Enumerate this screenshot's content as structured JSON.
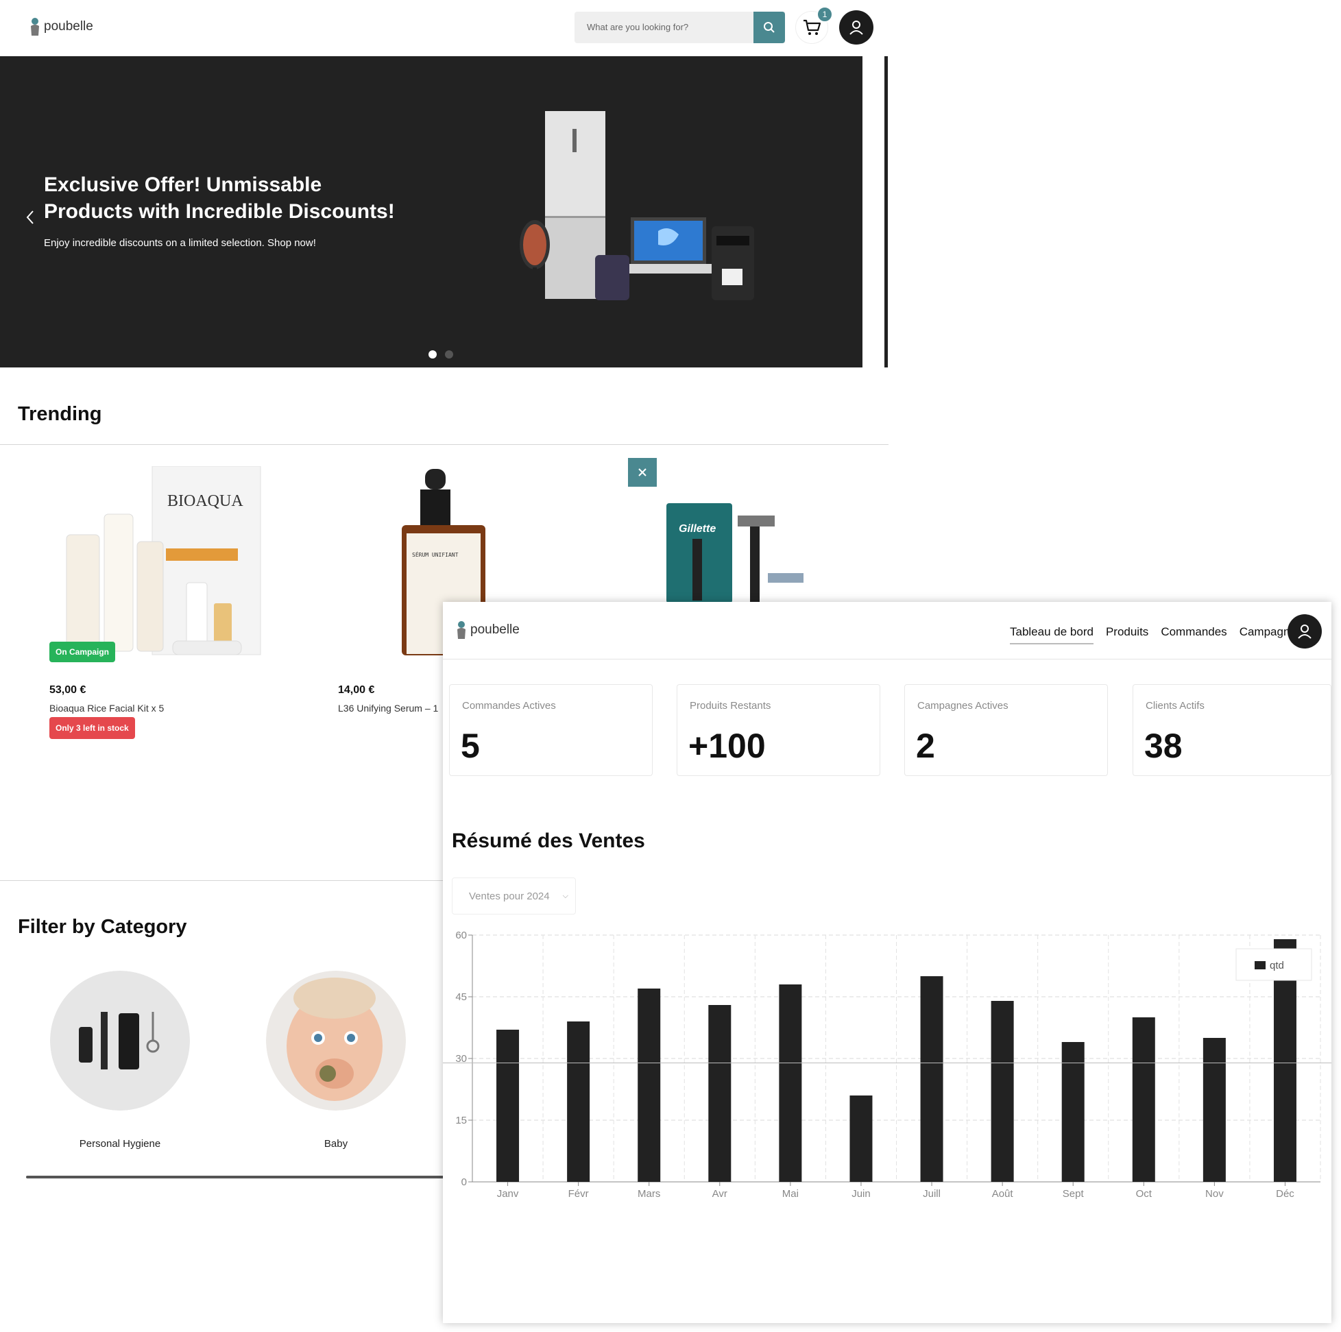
{
  "store": {
    "logo_text": "poubelle",
    "search_placeholder": "What are you looking for?",
    "cart_count": "1",
    "hero": {
      "title": "Exclusive Offer! Unmissable Products with Incredible Discounts!",
      "subtitle": "Enjoy incredible discounts on a limited selection. Shop now!"
    },
    "trending_title": "Trending",
    "products": [
      {
        "price": "53,00 €",
        "name": "Bioaqua Rice Facial Kit x 5",
        "campaign_badge": "On Campaign",
        "stock_badge": "Only 3 left in stock",
        "img_text": "BIOAQUA"
      },
      {
        "price": "14,00 €",
        "name": "L36 Unifying Serum – 1",
        "img_text": "SÉRUM UNIFIANT"
      },
      {
        "img_text": "Gillette"
      }
    ],
    "category_title": "Filter by Category",
    "categories": [
      {
        "label": "Personal Hygiene"
      },
      {
        "label": "Baby"
      }
    ]
  },
  "admin": {
    "logo_text": "poubelle",
    "nav": [
      "Tableau de bord",
      "Produits",
      "Commandes",
      "Campagnes"
    ],
    "kpis": [
      {
        "label": "Commandes Actives",
        "value": "5"
      },
      {
        "label": "Produits Restants",
        "value": "+100"
      },
      {
        "label": "Campagnes Actives",
        "value": "2"
      },
      {
        "label": "Clients Actifs",
        "value": "38"
      }
    ],
    "sales_title": "Résumé des Ventes",
    "year_select": "Ventes pour 2024"
  },
  "colors": {
    "accent": "#4a8890",
    "bar": "#222222",
    "green": "#27b35a",
    "red": "#e5484d"
  },
  "chart_data": {
    "type": "bar",
    "categories": [
      "Janv",
      "Févr",
      "Mars",
      "Avr",
      "Mai",
      "Juin",
      "Juill",
      "Août",
      "Sept",
      "Oct",
      "Nov",
      "Déc"
    ],
    "series": [
      {
        "name": "qtd",
        "values": [
          37,
          39,
          47,
          43,
          48,
          21,
          50,
          44,
          34,
          40,
          35,
          59
        ]
      }
    ],
    "yticks": [
      0,
      15,
      30,
      45,
      60
    ],
    "ylim": [
      0,
      60
    ],
    "grid": true,
    "legend": "top-right"
  }
}
